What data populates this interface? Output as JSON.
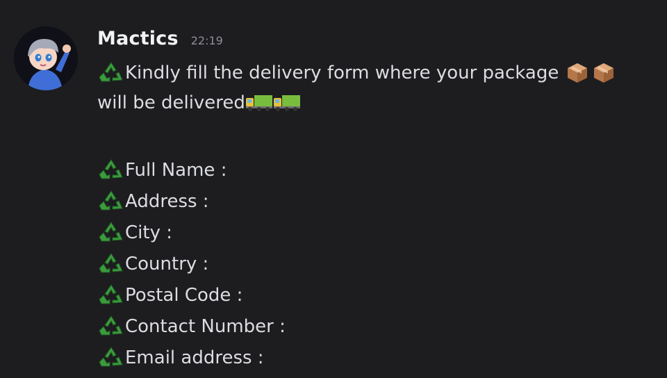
{
  "message": {
    "username": "Mactics",
    "timestamp": "22:19",
    "intro_line1": "Kindly fill the delivery form where your package",
    "intro_line2": "will be delivered",
    "fields": [
      "Full Name :",
      "Address :",
      "City :",
      "Country :",
      "Postal Code :",
      "Contact Number :",
      "Email address :"
    ]
  },
  "icons": {
    "bullet": "recycling-symbol-icon",
    "package": "package-box-icon",
    "truck": "delivery-truck-icon"
  },
  "colors": {
    "background": "#1d1d20",
    "username": "#f2f3f5",
    "text": "#dcdde1",
    "timestamp": "#8e9097",
    "recycle_green": "#3f9a3f",
    "box_brown": "#c98b5c",
    "truck_green": "#7bc043"
  }
}
